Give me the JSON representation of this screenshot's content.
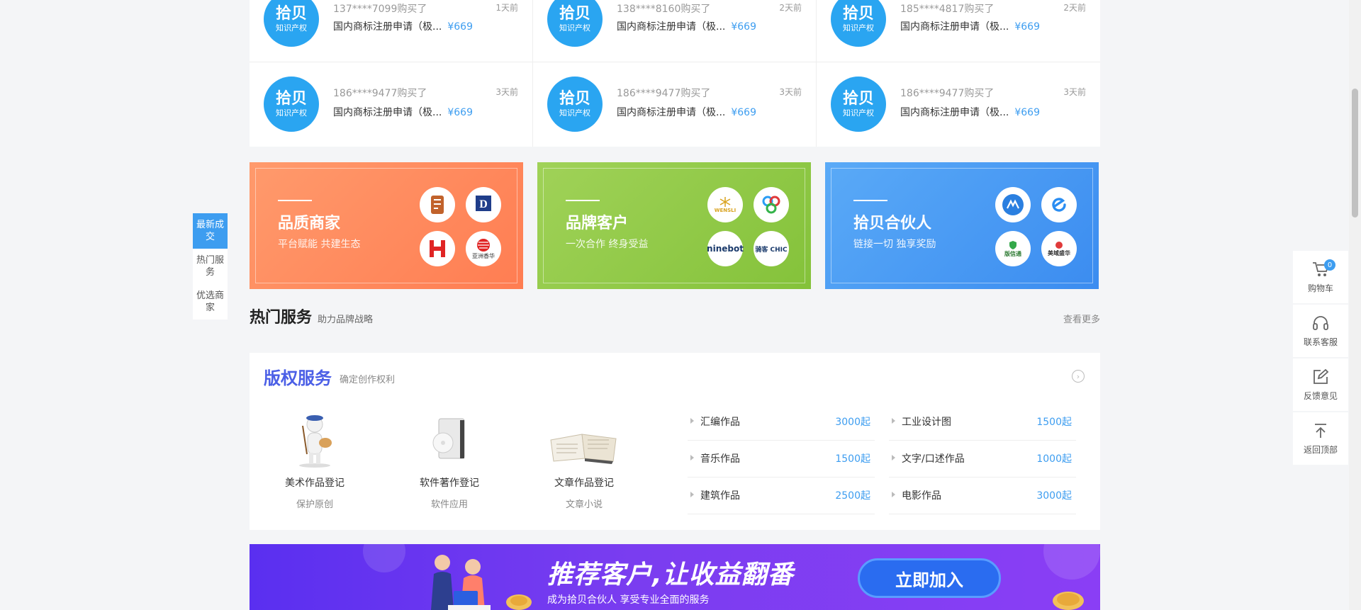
{
  "left_nav": [
    {
      "label": "最新成交",
      "active": true
    },
    {
      "label": "热门服务",
      "active": false
    },
    {
      "label": "优选商家",
      "active": false
    }
  ],
  "right_bar": {
    "cart_count": "0",
    "items": [
      {
        "label": "购物车",
        "icon": "cart-icon"
      },
      {
        "label": "联系客服",
        "icon": "headset-icon"
      },
      {
        "label": "反馈意见",
        "icon": "edit-icon"
      },
      {
        "label": "返回顶部",
        "icon": "arrow-up-icon"
      }
    ]
  },
  "deals": [
    {
      "logo_main": "拾贝",
      "logo_sub": "知识产权",
      "buyer": "137****7099购买了",
      "time": "1天前",
      "title": "国内商标注册申请（极...",
      "price": "¥669"
    },
    {
      "logo_main": "拾贝",
      "logo_sub": "知识产权",
      "buyer": "138****8160购买了",
      "time": "2天前",
      "title": "国内商标注册申请（极...",
      "price": "¥669"
    },
    {
      "logo_main": "拾贝",
      "logo_sub": "知识产权",
      "buyer": "185****4817购买了",
      "time": "2天前",
      "title": "国内商标注册申请（极...",
      "price": "¥669"
    },
    {
      "logo_main": "拾贝",
      "logo_sub": "知识产权",
      "buyer": "186****9477购买了",
      "time": "3天前",
      "title": "国内商标注册申请（极...",
      "price": "¥669"
    },
    {
      "logo_main": "拾贝",
      "logo_sub": "知识产权",
      "buyer": "186****9477购买了",
      "time": "3天前",
      "title": "国内商标注册申请（极...",
      "price": "¥669"
    },
    {
      "logo_main": "拾贝",
      "logo_sub": "知识产权",
      "buyer": "186****9477购买了",
      "time": "3天前",
      "title": "国内商标注册申请（极...",
      "price": "¥669"
    }
  ],
  "promos": [
    {
      "title": "品质商家",
      "subtitle": "平台赋能 共建生态",
      "logos": [
        "",
        "",
        "",
        "亚洲香华"
      ]
    },
    {
      "title": "品牌客户",
      "subtitle": "一次合作 终身受益",
      "logos": [
        "WENSLI",
        "",
        "ninebot",
        "骑客 CHIC"
      ]
    },
    {
      "title": "拾贝合伙人",
      "subtitle": "链接一切 独享奖励",
      "logos": [
        "",
        "",
        "版信通",
        "美域盛华"
      ]
    }
  ],
  "hot": {
    "title": "热门服务",
    "subtitle": "助力品牌战略",
    "more": "查看更多"
  },
  "copyright": {
    "title": "版权服务",
    "subtitle": "确定创作权利",
    "categories": [
      {
        "name": "美术作品登记",
        "desc": "保护原创"
      },
      {
        "name": "软件著作登记",
        "desc": "软件应用"
      },
      {
        "name": "文章作品登记",
        "desc": "文章小说"
      }
    ],
    "items": [
      {
        "name": "汇编作品",
        "price": "3000起"
      },
      {
        "name": "工业设计图",
        "price": "1500起"
      },
      {
        "name": "音乐作品",
        "price": "1500起"
      },
      {
        "name": "文字/口述作品",
        "price": "1000起"
      },
      {
        "name": "建筑作品",
        "price": "2500起"
      },
      {
        "name": "电影作品",
        "price": "3000起"
      }
    ]
  },
  "banner": {
    "headline": "推荐客户,让收益翻番",
    "sub": "成为拾贝合伙人 享受专业全面的服务",
    "button": "立即加入"
  }
}
